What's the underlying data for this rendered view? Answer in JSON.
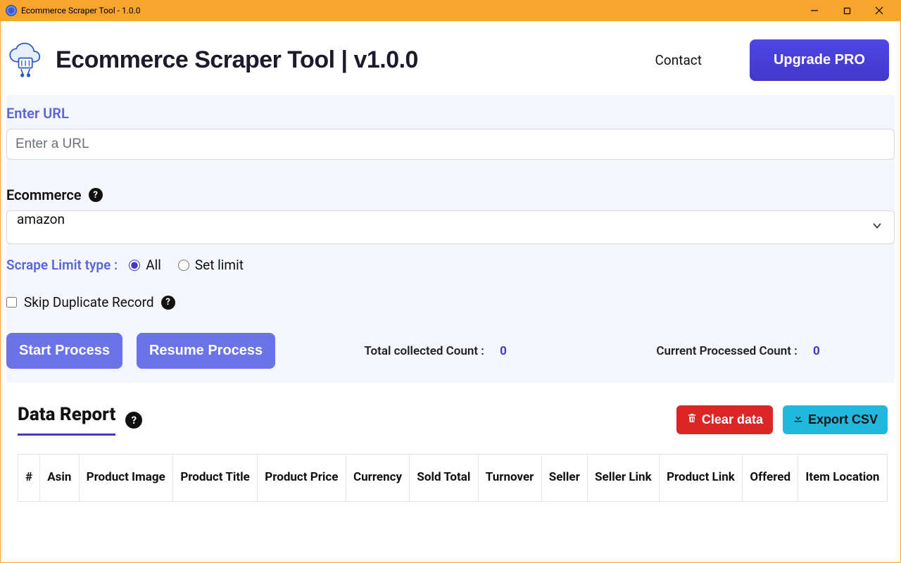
{
  "window": {
    "title": "Ecommerce Scraper Tool - 1.0.0"
  },
  "header": {
    "title": "Ecommerce Scraper Tool | v1.0.0",
    "contact": "Contact",
    "upgrade": "Upgrade PRO"
  },
  "form": {
    "url_label": "Enter URL",
    "url_placeholder": "Enter a URL",
    "url_value": "",
    "ecommerce_label": "Ecommerce",
    "ecommerce_value": "amazon",
    "limit_label": "Scrape Limit type :",
    "limit_all": "All",
    "limit_set": "Set limit",
    "limit_selected": "all",
    "skip_dup_label": "Skip Duplicate Record",
    "skip_dup_checked": false
  },
  "actions": {
    "start": "Start Process",
    "resume": "Resume Process"
  },
  "counts": {
    "total_label": "Total collected Count :",
    "total_value": "0",
    "current_label": "Current Processed Count :",
    "current_value": "0"
  },
  "report": {
    "title": "Data Report",
    "clear": "Clear data",
    "export": "Export CSV",
    "columns": [
      "#",
      "Asin",
      "Product Image",
      "Product Title",
      "Product Price",
      "Currency",
      "Sold Total",
      "Turnover",
      "Seller",
      "Seller Link",
      "Product Link",
      "Offered",
      "Item Location"
    ]
  }
}
